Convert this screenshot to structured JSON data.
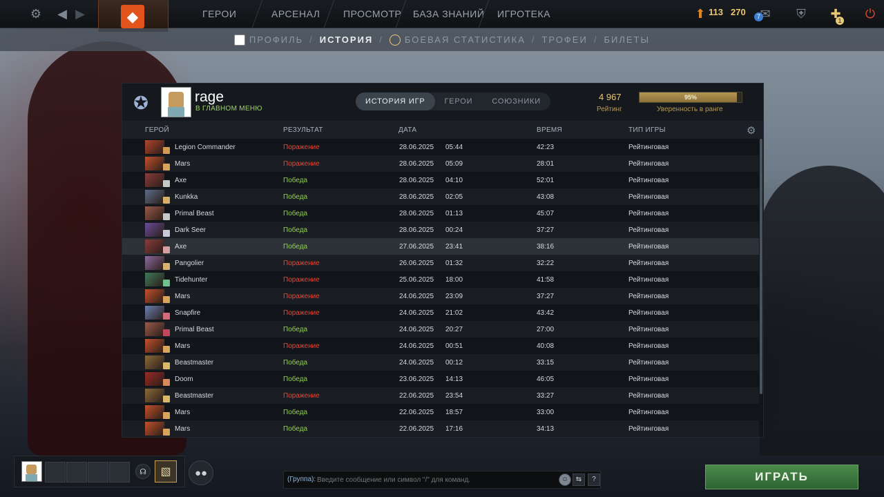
{
  "topbar": {
    "nav": [
      "ГЕРОИ",
      "АРСЕНАЛ",
      "ПРОСМОТР",
      "БАЗА ЗНАНИЙ",
      "ИГРОТЕКА"
    ],
    "shards": "113",
    "shards_sub": "270",
    "notif_count": "7",
    "badge_count": "1"
  },
  "subnav": {
    "items": [
      "ПРОФИЛЬ",
      "ИСТОРИЯ",
      "БОЕВАЯ СТАТИСТИКА",
      "ТРОФЕИ",
      "БИЛЕТЫ"
    ],
    "separator": "/"
  },
  "profile": {
    "name": "rage",
    "status": "В ГЛАВНОМ МЕНЮ",
    "rating_value": "4 967",
    "rating_label": "Рейтинг",
    "confidence_percent": 95,
    "confidence_text": "95%",
    "confidence_label": "Уверенность в ранге"
  },
  "tabs": [
    "ИСТОРИЯ ИГР",
    "ГЕРОИ",
    "СОЮЗНИКИ"
  ],
  "columns": {
    "hero": "ГЕРОЙ",
    "result": "РЕЗУЛЬТАТ",
    "date": "ДАТА",
    "duration": "ВРЕМЯ",
    "mode": "ТИП ИГРЫ"
  },
  "matches": [
    {
      "hero": "Legion Commander",
      "result": "Поражение",
      "win": false,
      "date": "28.06.2025",
      "time": "05:44",
      "duration": "42:23",
      "mode": "Рейтинговая",
      "color": "#b0452c",
      "badge": "#d39a56"
    },
    {
      "hero": "Mars",
      "result": "Поражение",
      "win": false,
      "date": "28.06.2025",
      "time": "05:09",
      "duration": "28:01",
      "mode": "Рейтинговая",
      "color": "#c2512b",
      "badge": "#d9a55c"
    },
    {
      "hero": "Axe",
      "result": "Победа",
      "win": true,
      "date": "28.06.2025",
      "time": "04:10",
      "duration": "52:01",
      "mode": "Рейтинговая",
      "color": "#8a3c3a",
      "badge": "#c8c8c8"
    },
    {
      "hero": "Kunkka",
      "result": "Победа",
      "win": true,
      "date": "28.06.2025",
      "time": "02:05",
      "duration": "43:08",
      "mode": "Рейтинговая",
      "color": "#5b6d8a",
      "badge": "#d6b06a"
    },
    {
      "hero": "Primal Beast",
      "result": "Победа",
      "win": true,
      "date": "28.06.2025",
      "time": "01:13",
      "duration": "45:07",
      "mode": "Рейтинговая",
      "color": "#9a5a4a",
      "badge": "#c8c8c8"
    },
    {
      "hero": "Dark Seer",
      "result": "Победа",
      "win": true,
      "date": "28.06.2025",
      "time": "00:24",
      "duration": "37:27",
      "mode": "Рейтинговая",
      "color": "#6a4d9a",
      "badge": "#c8c8d8"
    },
    {
      "hero": "Axe",
      "result": "Победа",
      "win": true,
      "date": "27.06.2025",
      "time": "23:41",
      "duration": "38:16",
      "mode": "Рейтинговая",
      "color": "#8a3c3a",
      "badge": "#d7a0a0"
    },
    {
      "hero": "Pangolier",
      "result": "Поражение",
      "win": false,
      "date": "26.06.2025",
      "time": "01:32",
      "duration": "32:22",
      "mode": "Рейтинговая",
      "color": "#8d6a9e",
      "badge": "#d8b070"
    },
    {
      "hero": "Tidehunter",
      "result": "Поражение",
      "win": false,
      "date": "25.06.2025",
      "time": "18:00",
      "duration": "41:58",
      "mode": "Рейтинговая",
      "color": "#3d7a5a",
      "badge": "#6fc08a"
    },
    {
      "hero": "Mars",
      "result": "Поражение",
      "win": false,
      "date": "24.06.2025",
      "time": "23:09",
      "duration": "37:27",
      "mode": "Рейтинговая",
      "color": "#c2512b",
      "badge": "#d9a55c"
    },
    {
      "hero": "Snapfire",
      "result": "Поражение",
      "win": false,
      "date": "24.06.2025",
      "time": "21:02",
      "duration": "43:42",
      "mode": "Рейтинговая",
      "color": "#6a7fb0",
      "badge": "#d26a7a"
    },
    {
      "hero": "Primal Beast",
      "result": "Победа",
      "win": true,
      "date": "24.06.2025",
      "time": "20:27",
      "duration": "27:00",
      "mode": "Рейтинговая",
      "color": "#9a5a4a",
      "badge": "#c0485a"
    },
    {
      "hero": "Mars",
      "result": "Поражение",
      "win": false,
      "date": "24.06.2025",
      "time": "00:51",
      "duration": "40:08",
      "mode": "Рейтинговая",
      "color": "#c2512b",
      "badge": "#d9a55c"
    },
    {
      "hero": "Beastmaster",
      "result": "Победа",
      "win": true,
      "date": "24.06.2025",
      "time": "00:12",
      "duration": "33:15",
      "mode": "Рейтинговая",
      "color": "#8b6a3a",
      "badge": "#d9b86a"
    },
    {
      "hero": "Doom",
      "result": "Победа",
      "win": true,
      "date": "23.06.2025",
      "time": "14:13",
      "duration": "46:05",
      "mode": "Рейтинговая",
      "color": "#9a2a24",
      "badge": "#d88a5a"
    },
    {
      "hero": "Beastmaster",
      "result": "Поражение",
      "win": false,
      "date": "22.06.2025",
      "time": "23:54",
      "duration": "33:27",
      "mode": "Рейтинговая",
      "color": "#8b6a3a",
      "badge": "#d9b86a"
    },
    {
      "hero": "Mars",
      "result": "Победа",
      "win": true,
      "date": "22.06.2025",
      "time": "18:57",
      "duration": "33:00",
      "mode": "Рейтинговая",
      "color": "#c2512b",
      "badge": "#d9a55c"
    },
    {
      "hero": "Mars",
      "result": "Победа",
      "win": true,
      "date": "22.06.2025",
      "time": "17:16",
      "duration": "34:13",
      "mode": "Рейтинговая",
      "color": "#c2512b",
      "badge": "#d9a55c"
    }
  ],
  "chat": {
    "channel": "(Группа):",
    "placeholder": "Введите сообщение или символ \"/\" для команд.",
    "help": "?"
  },
  "play_button": "ИГРАТЬ",
  "colors": {
    "win": "#8fd34b",
    "loss": "#e8473a",
    "accent": "#e9c873",
    "play": "#3d7a3d"
  }
}
